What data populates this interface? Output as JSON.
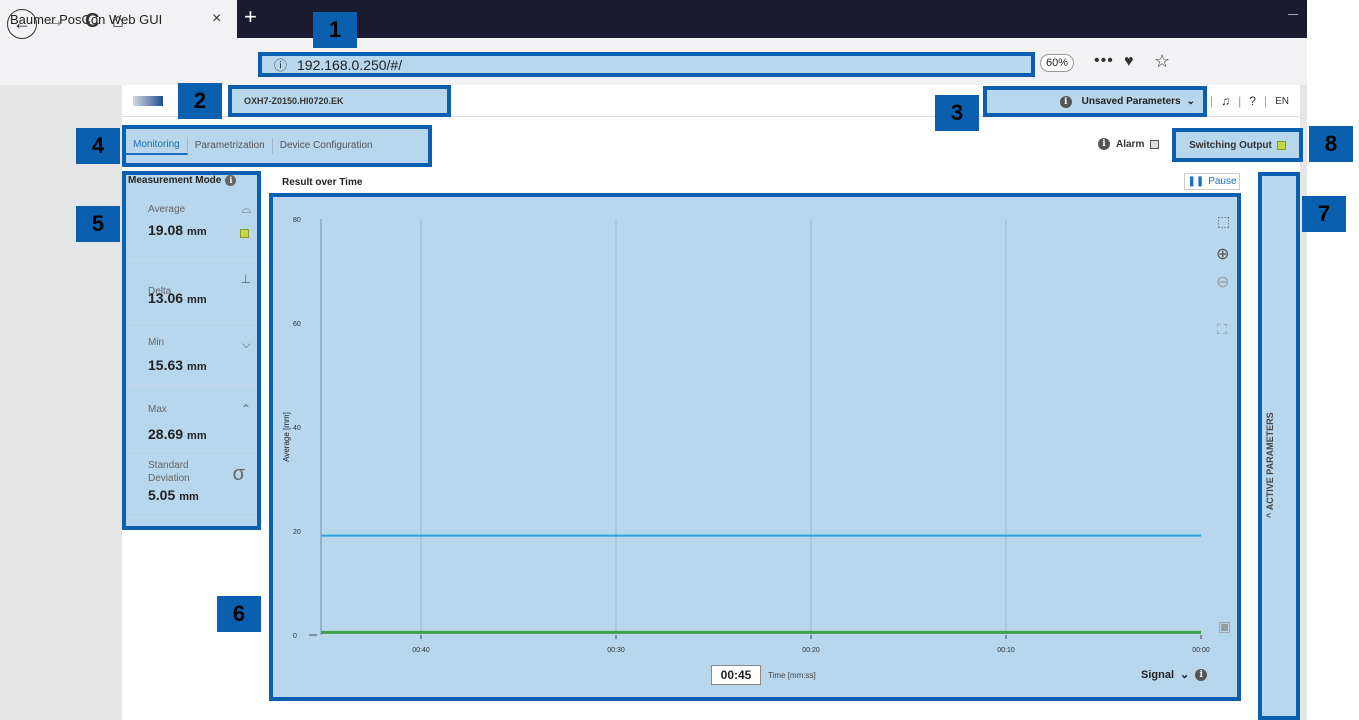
{
  "browser": {
    "tab_title": "Baumer PosCon Web GUI",
    "tab_close": "×",
    "new_tab": "+",
    "back": "←",
    "forward": "→",
    "reload": "C",
    "home": "⌂",
    "url_info": "ⓘ",
    "url": "192.168.0.250/#/",
    "zoom": "60%",
    "more": "•••",
    "pocket": "♥",
    "bookmark": "☆"
  },
  "header": {
    "device_name": "OXH7-Z0150.HI0720.EK",
    "unsaved_label": "Unsaved Parameters",
    "unsaved_chevron": "⌄",
    "icons": [
      "♫",
      "?",
      "EN"
    ]
  },
  "nav": {
    "tabs": [
      "Monitoring",
      "Parametrization",
      "Device Configuration"
    ],
    "alarm_label": "Alarm",
    "switching_output_label": "Switching Output"
  },
  "measurement_mode": {
    "title": "Measurement Mode",
    "items": [
      {
        "label": "Average",
        "value": "19.08",
        "unit": "mm"
      },
      {
        "label": "Delta",
        "value": "13.06",
        "unit": "mm"
      },
      {
        "label": "Min",
        "value": "15.63",
        "unit": "mm"
      },
      {
        "label": "Max",
        "value": "28.69",
        "unit": "mm"
      },
      {
        "label_line1": "Standard",
        "label_line2": "Deviation",
        "value": "5.05",
        "unit": "mm",
        "symbol": "σ"
      }
    ]
  },
  "chart": {
    "title": "Result over Time",
    "pause_label": "Pause",
    "time_readout": "00:45",
    "time_axis_label": "Time [mm:ss]",
    "signal_label": "Signal"
  },
  "chart_data": {
    "type": "line",
    "ylabel": "Average [mm]",
    "xlabel": "Time [mm:ss]",
    "ylim": [
      0,
      80
    ],
    "yticks": [
      "0",
      "20",
      "40",
      "60",
      "80"
    ],
    "xticks": [
      "00:40",
      "00:30",
      "00:20",
      "00:10",
      "00:00"
    ],
    "series": [
      {
        "values": [
          19.1,
          19.1,
          19.1,
          19.1,
          19.1,
          19.1
        ],
        "color": "#2aa3e0"
      },
      {
        "values": [
          0.5,
          0.5,
          0.5,
          0.5,
          0.5,
          0.5
        ],
        "color": "#3fa046"
      }
    ]
  },
  "active_parameters": {
    "label": "ACTIVE PARAMETERS",
    "chevron": "^"
  },
  "badges": [
    "1",
    "2",
    "3",
    "4",
    "5",
    "6",
    "7",
    "8"
  ],
  "colors": {
    "highlight_fill": "#b8d6ec",
    "highlight_border": "#0a5fae",
    "accent": "#1d6fbf",
    "led": "#c8d64a"
  }
}
